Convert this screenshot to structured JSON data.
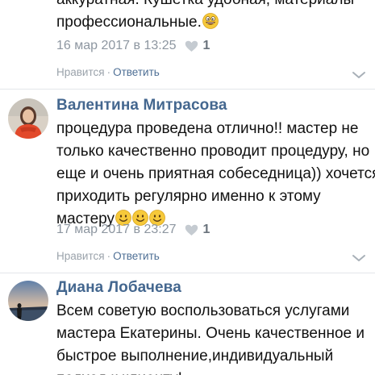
{
  "comments": [
    {
      "author": "",
      "lines": [
        "аккуратная. Кушетка удобная, материалы",
        "профессиональные."
      ],
      "emoji": [
        "grinning-emoji"
      ],
      "date": "16 мар 2017 в 13:25",
      "likes": "1",
      "like_label": "Нравится",
      "separator": "·",
      "reply_label": "Ответить"
    },
    {
      "author": "Валентина Митрасова",
      "lines": [
        "процедура проведена отлично!! мастер не",
        "только качественно проводит процедуру, но",
        "еще и очень приятная собеседница)) хочется",
        "приходить регулярно именно к этому",
        "мастеру"
      ],
      "emoji": [
        "smile-emoji",
        "smile-emoji",
        "smile-emoji"
      ],
      "date": "17 мар 2017 в 23:27",
      "likes": "1",
      "like_label": "Нравится",
      "separator": "·",
      "reply_label": "Ответить"
    },
    {
      "author": "Диана Лобачева",
      "lines": [
        "Всем советую воспользоваться услугами",
        "мастера Екатерины. Очень качественное и",
        "быстрое выполнение,индивидуальный",
        "подход к клиенту!"
      ]
    }
  ],
  "colors": {
    "author": "#44678f",
    "meta": "#8d96a0",
    "reply": "#4e6f95",
    "emoji": "#f6c93a"
  }
}
